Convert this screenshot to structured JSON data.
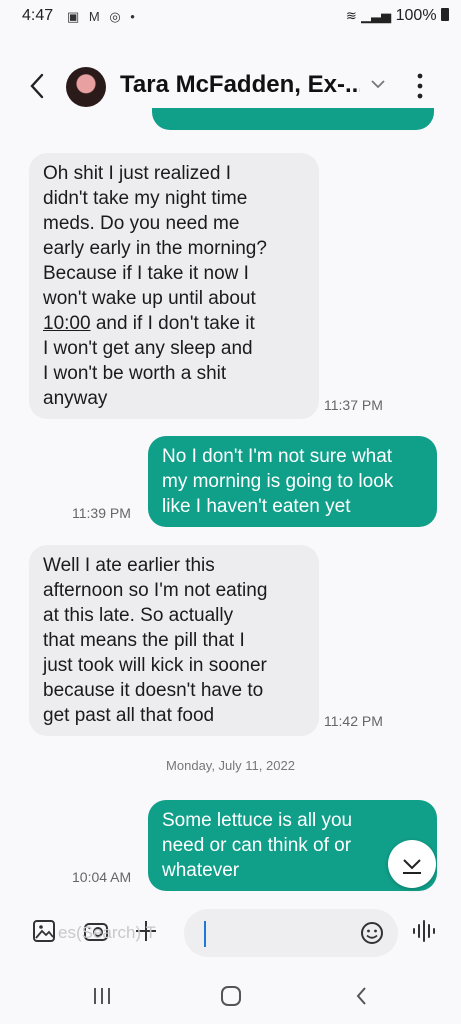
{
  "status_bar": {
    "time": "4:47",
    "battery": "100%"
  },
  "header": {
    "contact_name": "Tara McFadden, Ex-..."
  },
  "messages": [
    {
      "dir": "in",
      "lines": [
        "Oh shit I just realized I",
        "didn't take my night time",
        "meds. Do you need me",
        "early early in the morning?",
        "Because if I take it now I",
        "won't wake up until about",
        "10:00|and if I don't take it",
        "I won't get any sleep and",
        "I won't be worth a shit",
        "anyway"
      ],
      "time": "11:37 PM"
    },
    {
      "dir": "out",
      "lines": [
        "No I don't I'm not sure what",
        "my morning is going to look",
        "like I haven't eaten yet"
      ],
      "time": "11:39 PM"
    },
    {
      "dir": "in",
      "lines": [
        "Well I ate earlier this",
        "afternoon so I'm not eating",
        "at this late. So actually",
        "that means the pill that I",
        "just took will kick in sooner",
        "because it doesn't have to",
        "get past all that food"
      ],
      "time": "11:42 PM"
    },
    {
      "dir": "out",
      "lines": [
        "Some lettuce is all you",
        "need or can think of or",
        "whatever"
      ],
      "time": "10:04 AM"
    }
  ],
  "date_separator": "Monday, July 11, 2022",
  "composer": {
    "hint": "es(Search) T"
  }
}
